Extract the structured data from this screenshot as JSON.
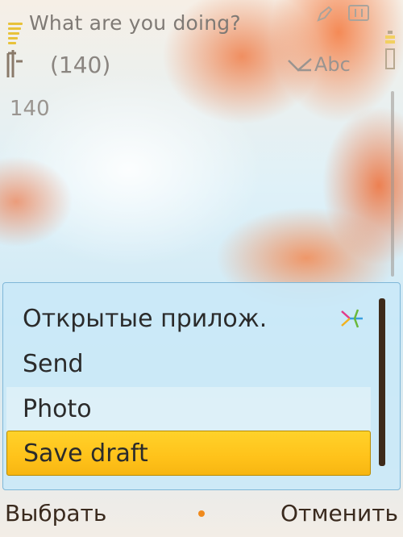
{
  "header": {
    "title": "What are you doing?",
    "char_counter": "(140)",
    "input_mode": "Abc"
  },
  "body": {
    "remaining_chars": "140"
  },
  "menu": {
    "items": [
      {
        "label": "Открытые прилож."
      },
      {
        "label": "Send"
      },
      {
        "label": "Photo"
      },
      {
        "label": "Save draft"
      }
    ],
    "selected_index": 3
  },
  "softkeys": {
    "left": "Выбрать",
    "right": "Отменить"
  },
  "colors": {
    "selection": "#ffc21a",
    "menu_background": "#cae8f7",
    "softkey_text": "#3a2a1e",
    "center_dot": "#f08a1c"
  },
  "icons": [
    "signal-strength-icon",
    "edit-icon",
    "keyboard-icon",
    "battery-icon",
    "pen-input-icon",
    "open-apps-icon"
  ]
}
